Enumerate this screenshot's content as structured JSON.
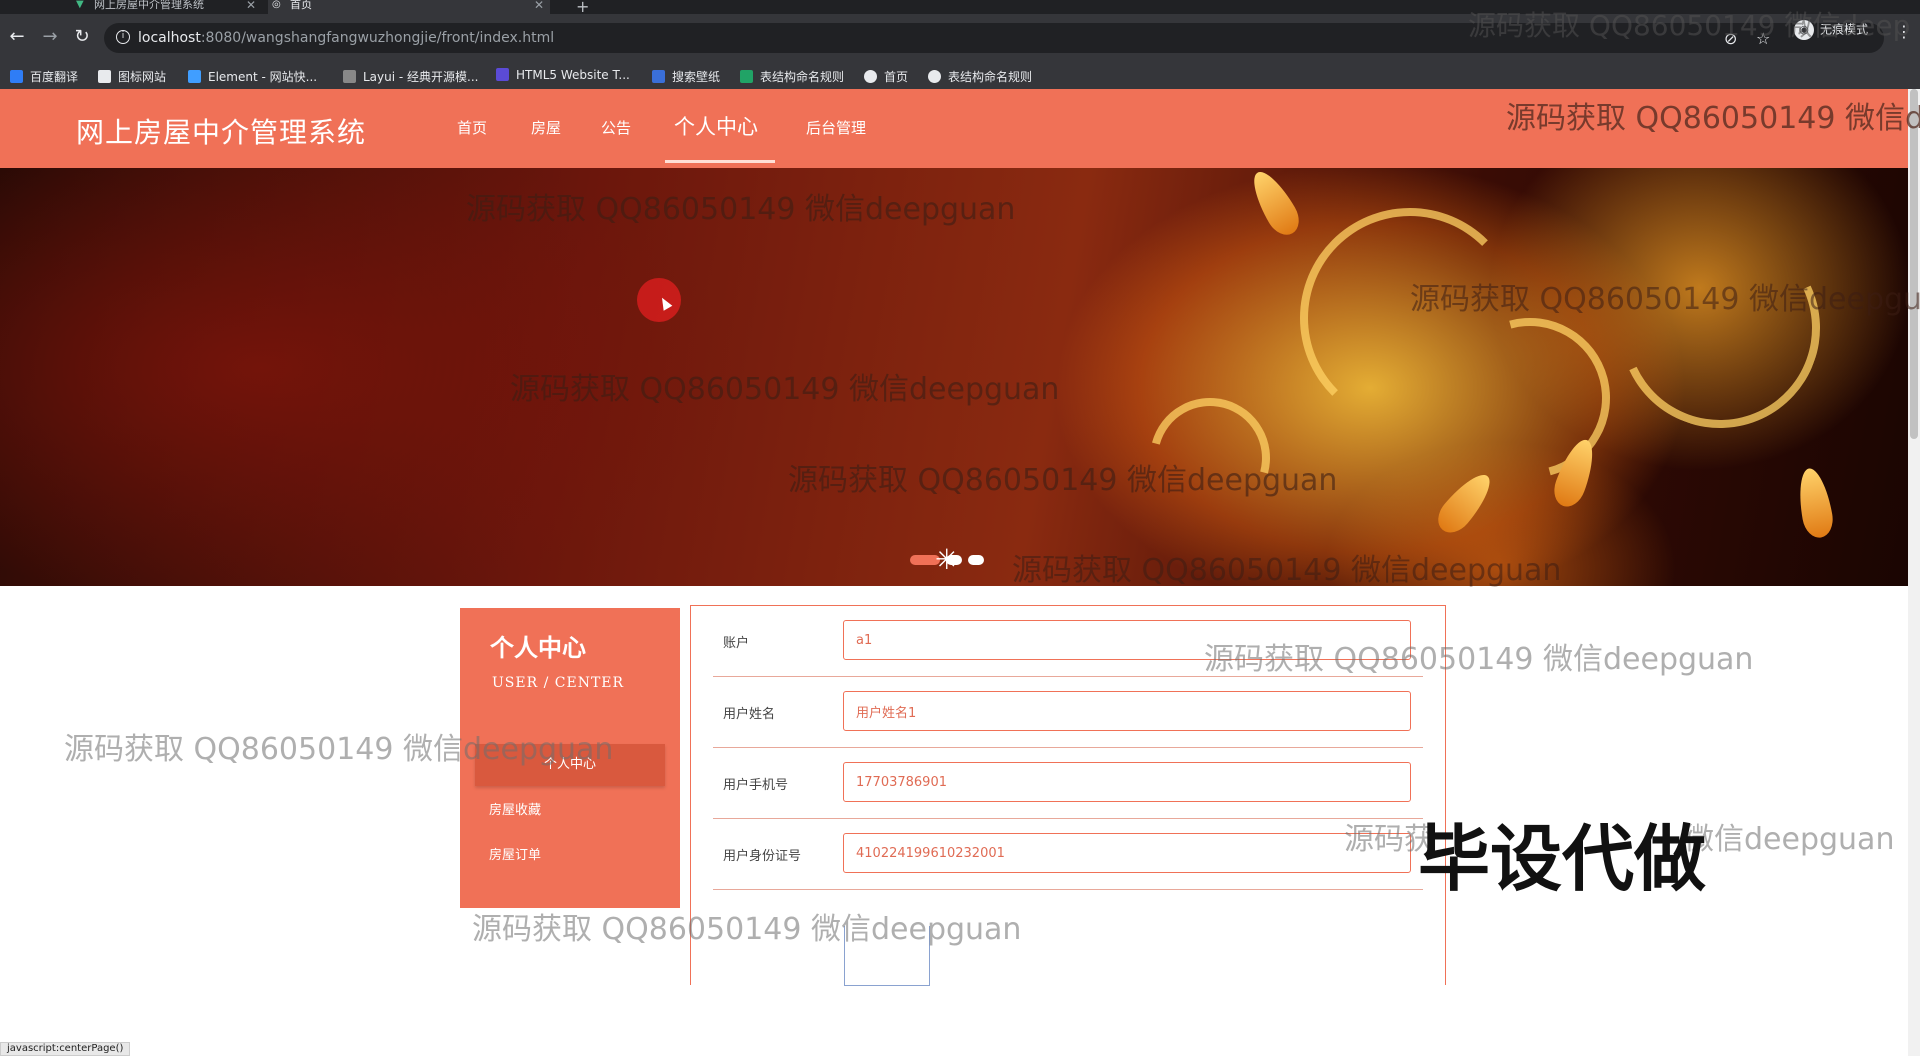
{
  "browser": {
    "tabs": [
      {
        "title": "网上房屋中介管理系统",
        "close": "✕"
      },
      {
        "title": "首页",
        "close": "✕"
      }
    ],
    "new_tab": "+",
    "url_host": "localhost",
    "url_path": ":8080/wangshangfangwuzhongjie/front/index.html",
    "profile_label": "无痕模式",
    "bookmarks": [
      "百度翻译",
      "图标网站",
      "Element - 网站快...",
      "Layui - 经典开源模...",
      "HTML5 Website T...",
      "搜索壁纸",
      "表结构命名规则",
      "首页",
      "表结构命名规则"
    ]
  },
  "header": {
    "logo": "网上房屋中介管理系统",
    "nav": [
      "首页",
      "房屋",
      "公告",
      "个人中心",
      "后台管理"
    ],
    "active_nav": "个人中心"
  },
  "banner": {
    "slide_count": 3,
    "active_slide": 1
  },
  "sidebar": {
    "title": "个人中心",
    "subtitle": "USER / CENTER",
    "items": [
      "个人中心",
      "房屋收藏",
      "房屋订单"
    ]
  },
  "form": {
    "fields": [
      {
        "label": "账户",
        "value": "a1"
      },
      {
        "label": "用户姓名",
        "value": "用户姓名1"
      },
      {
        "label": "用户手机号",
        "value": "17703786901"
      },
      {
        "label": "用户身份证号",
        "value": "410224199610232001"
      }
    ]
  },
  "status_bar": "javascript:centerPage()",
  "watermarks": {
    "text": "源码获取 QQ86050149 微信deepguan",
    "top_right": "源码获取 QQ86050149 微信deep",
    "header_right": "源码获取 QQ86050149 微信de",
    "banner_right": "源码获取 QQ86050149 微信deepguan",
    "dots_right": "源码获取 QQ86050149 微信deepguan",
    "promo": "毕设代做",
    "promo_left": "源码获",
    "promo_right": "微信deepguan"
  },
  "colors": {
    "accent": "#f07157",
    "accent_dark": "#d9593e",
    "chrome_dark": "#202124",
    "chrome": "#35363a"
  }
}
